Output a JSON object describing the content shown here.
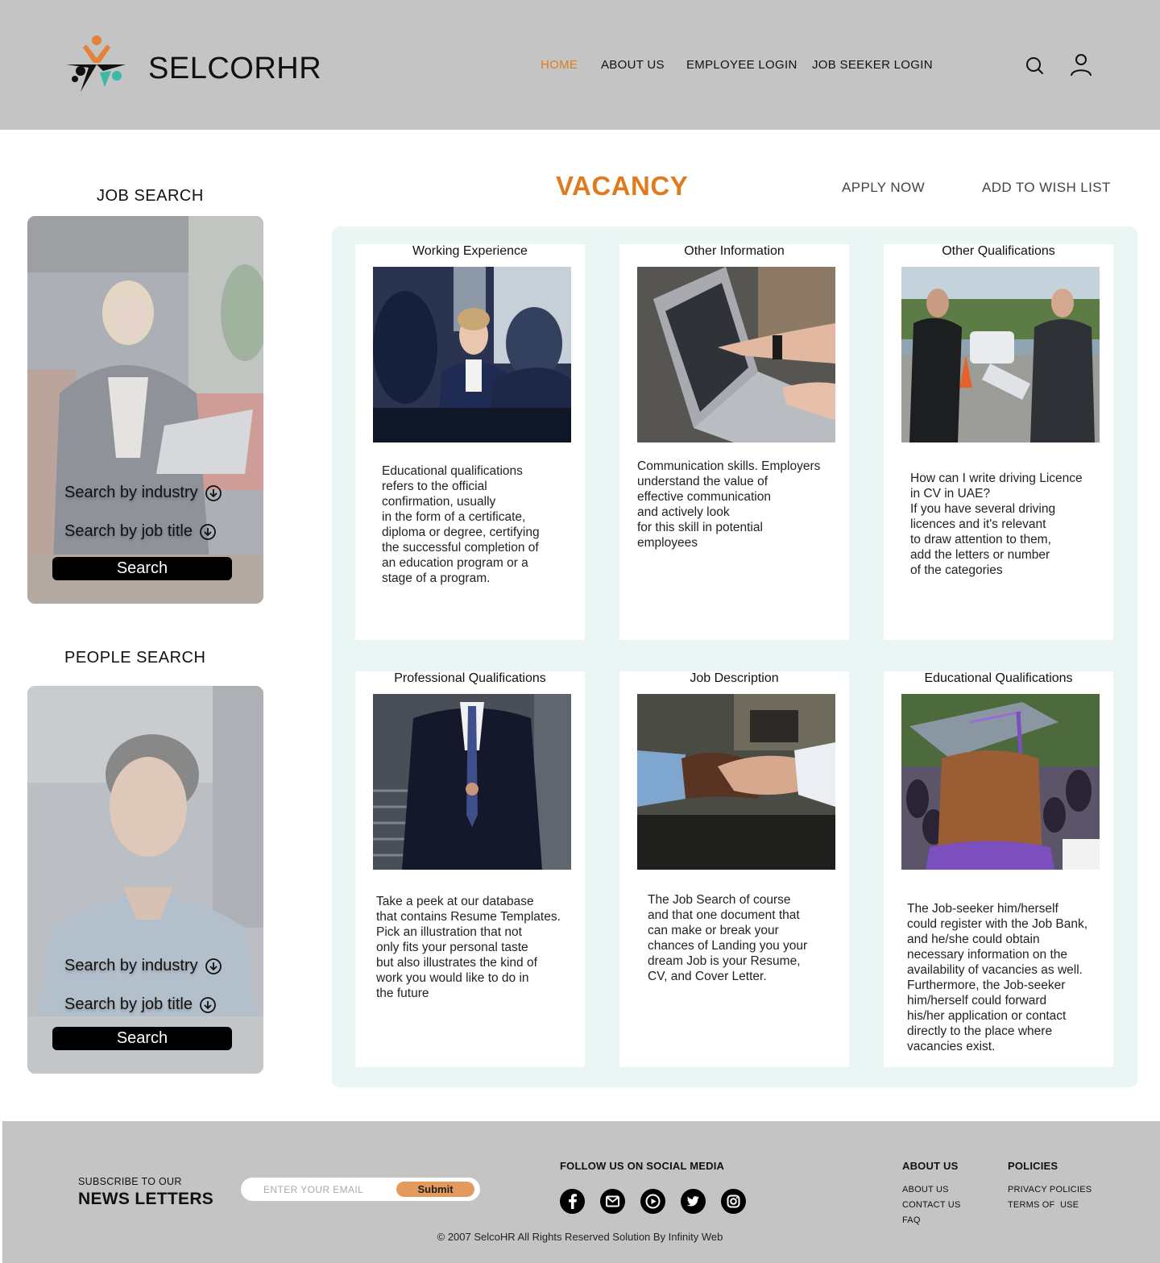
{
  "header": {
    "brand": "SELCORHR",
    "nav": [
      "HOME",
      "ABOUT US",
      "EMPLOYEE LOGIN",
      "JOB SEEKER LOGIN"
    ],
    "icons": [
      "search-icon",
      "user-icon"
    ],
    "accent_color": "#e07a1e"
  },
  "sidebar": {
    "job_search": {
      "title": "JOB SEARCH",
      "industry_label": "Search by industry",
      "job_title_label": "Search by job title",
      "button": "Search"
    },
    "people_search": {
      "title": "PEOPLE SEARCH",
      "industry_label": "Search by industry",
      "job_title_label": "Search by job title",
      "button": "Search"
    }
  },
  "main": {
    "title": "VACANCY",
    "apply_now": "APPLY NOW",
    "add_to_wish_list": "ADD TO WISH LIST",
    "cards": [
      {
        "title": "Working Experience",
        "text": "Educational qualifications\nrefers to the official\nconfirmation, usually\nin the form of a certificate,\ndiploma or degree, certifying\nthe successful completion of\nan education program or a\nstage of a program."
      },
      {
        "title": "Other Information",
        "text": "Communication skills. Employers\nunderstand the value of\neffective communication\nand actively look\nfor this skill in potential\n employees"
      },
      {
        "title": "Other Qualifications",
        "text": "How can I write driving Licence\n in CV in UAE?\nIf you have several driving\nlicences and it's relevant\nto draw attention to them,\nadd the letters or number\nof the categories"
      },
      {
        "title": "Professional Qualifications",
        "text": "Take a peek at our database\nthat contains Resume Templates.\nPick an illustration that not\nonly fits your personal taste\n but also illustrates the kind of\n work you would like to do in\n the future"
      },
      {
        "title": "Job Description",
        "text": "The Job Search of course\n and that one document that\n can make or break your\nchances of Landing you your\ndream Job is your Resume,\n CV, and Cover Letter."
      },
      {
        "title": "Educational Qualifications",
        "text": "The Job-seeker him/herself\ncould register with the Job Bank,\nand he/she could obtain\n necessary information on the\navailability of vacancies as well.\nFurthermore, the Job-seeker\nhim/herself could forward\nhis/her application or contact\n directly to the place where\nvacancies exist."
      }
    ]
  },
  "footer": {
    "subscribe_small": "SUBSCRIBE TO OUR",
    "subscribe_big": "NEWS LETTERS",
    "email_placeholder": "ENTER YOUR EMAIL",
    "submit": "Submit",
    "social_title": "FOLLOW US ON SOCIAL MEDIA",
    "social_icons": [
      "facebook-icon",
      "gmail-icon",
      "youtube-icon",
      "twitter-icon",
      "instagram-icon"
    ],
    "about_title": "ABOUT US",
    "about_links": [
      "ABOUT US",
      "CONTACT US",
      "FAQ"
    ],
    "policies_title": "POLICIES",
    "policies_links": [
      "PRIVACY POLICIES",
      "TERMS OF  USE"
    ],
    "copyright": "© 2007 SelcoHR All Rights Reserved Solution By Infinity Web"
  }
}
